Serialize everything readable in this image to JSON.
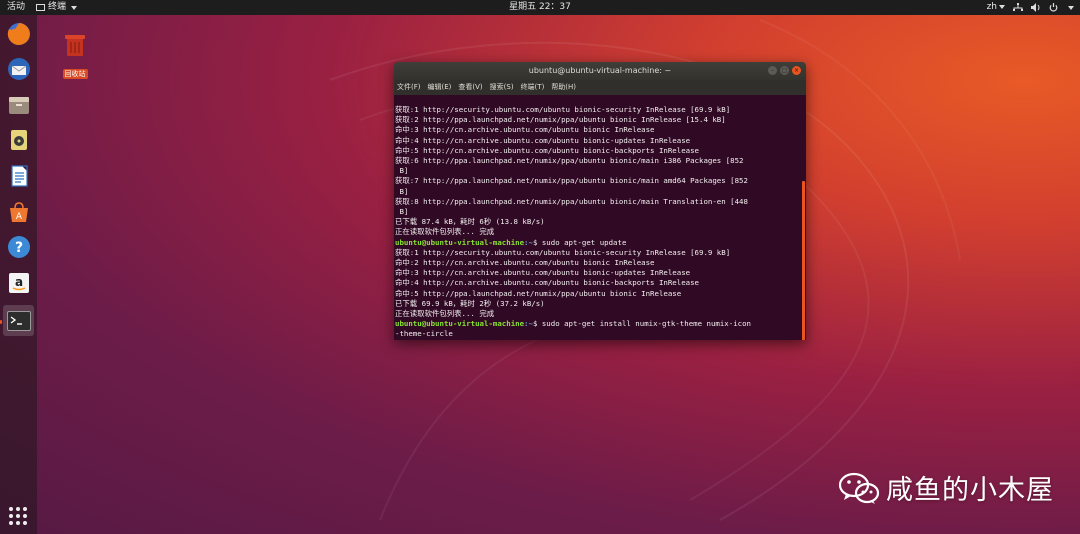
{
  "topbar": {
    "activities": "活动",
    "app_menu": "终端",
    "clock": "星期五 22：37",
    "input_method": "zh"
  },
  "dock": {
    "items": [
      "firefox-icon",
      "thunderbird-icon",
      "files-icon",
      "rhythmbox-icon",
      "libreoffice-writer-icon",
      "software-center-icon",
      "help-icon",
      "amazon-icon",
      "terminal-icon"
    ],
    "show_apps": "grid-icon"
  },
  "desktop": {
    "trash_label": "回收站"
  },
  "terminal": {
    "title": "ubuntu@ubuntu-virtual-machine: ~",
    "menus": [
      "文件(F)",
      "编辑(E)",
      "查看(V)",
      "搜索(S)",
      "终端(T)",
      "帮助(H)"
    ],
    "prompt_user": "ubuntu@ubuntu-virtual-machine",
    "prompt_path": ":~",
    "prompt_sym": "$ ",
    "lines": [
      "获取:1 http://security.ubuntu.com/ubuntu bionic-security InRelease [69.9 kB]",
      "获取:2 http://ppa.launchpad.net/numix/ppa/ubuntu bionic InRelease [15.4 kB]",
      "命中:3 http://cn.archive.ubuntu.com/ubuntu bionic InRelease",
      "命中:4 http://cn.archive.ubuntu.com/ubuntu bionic-updates InRelease",
      "命中:5 http://cn.archive.ubuntu.com/ubuntu bionic-backports InRelease",
      "获取:6 http://ppa.launchpad.net/numix/ppa/ubuntu bionic/main i386 Packages [852",
      " B]",
      "获取:7 http://ppa.launchpad.net/numix/ppa/ubuntu bionic/main amd64 Packages [852",
      " B]",
      "获取:8 http://ppa.launchpad.net/numix/ppa/ubuntu bionic/main Translation-en [448",
      " B]",
      "已下载 87.4 kB，耗时 6秒 (13.8 kB/s)",
      "正在读取软件包列表... 完成"
    ],
    "cmd1": "sudo apt-get update",
    "lines2": [
      "获取:1 http://security.ubuntu.com/ubuntu bionic-security InRelease [69.9 kB]",
      "命中:2 http://cn.archive.ubuntu.com/ubuntu bionic InRelease",
      "命中:3 http://cn.archive.ubuntu.com/ubuntu bionic-updates InRelease",
      "命中:4 http://cn.archive.ubuntu.com/ubuntu bionic-backports InRelease",
      "命中:5 http://ppa.launchpad.net/numix/ppa/ubuntu bionic InRelease",
      "已下载 69.9 kB，耗时 2秒 (37.2 kB/s)",
      "正在读取软件包列表... 完成"
    ],
    "cmd2": "sudo apt-get install numix-gtk-theme numix-icon",
    "cmd2_wrap": "-theme-circle"
  },
  "watermark": {
    "text": "咸鱼的小木屋"
  }
}
